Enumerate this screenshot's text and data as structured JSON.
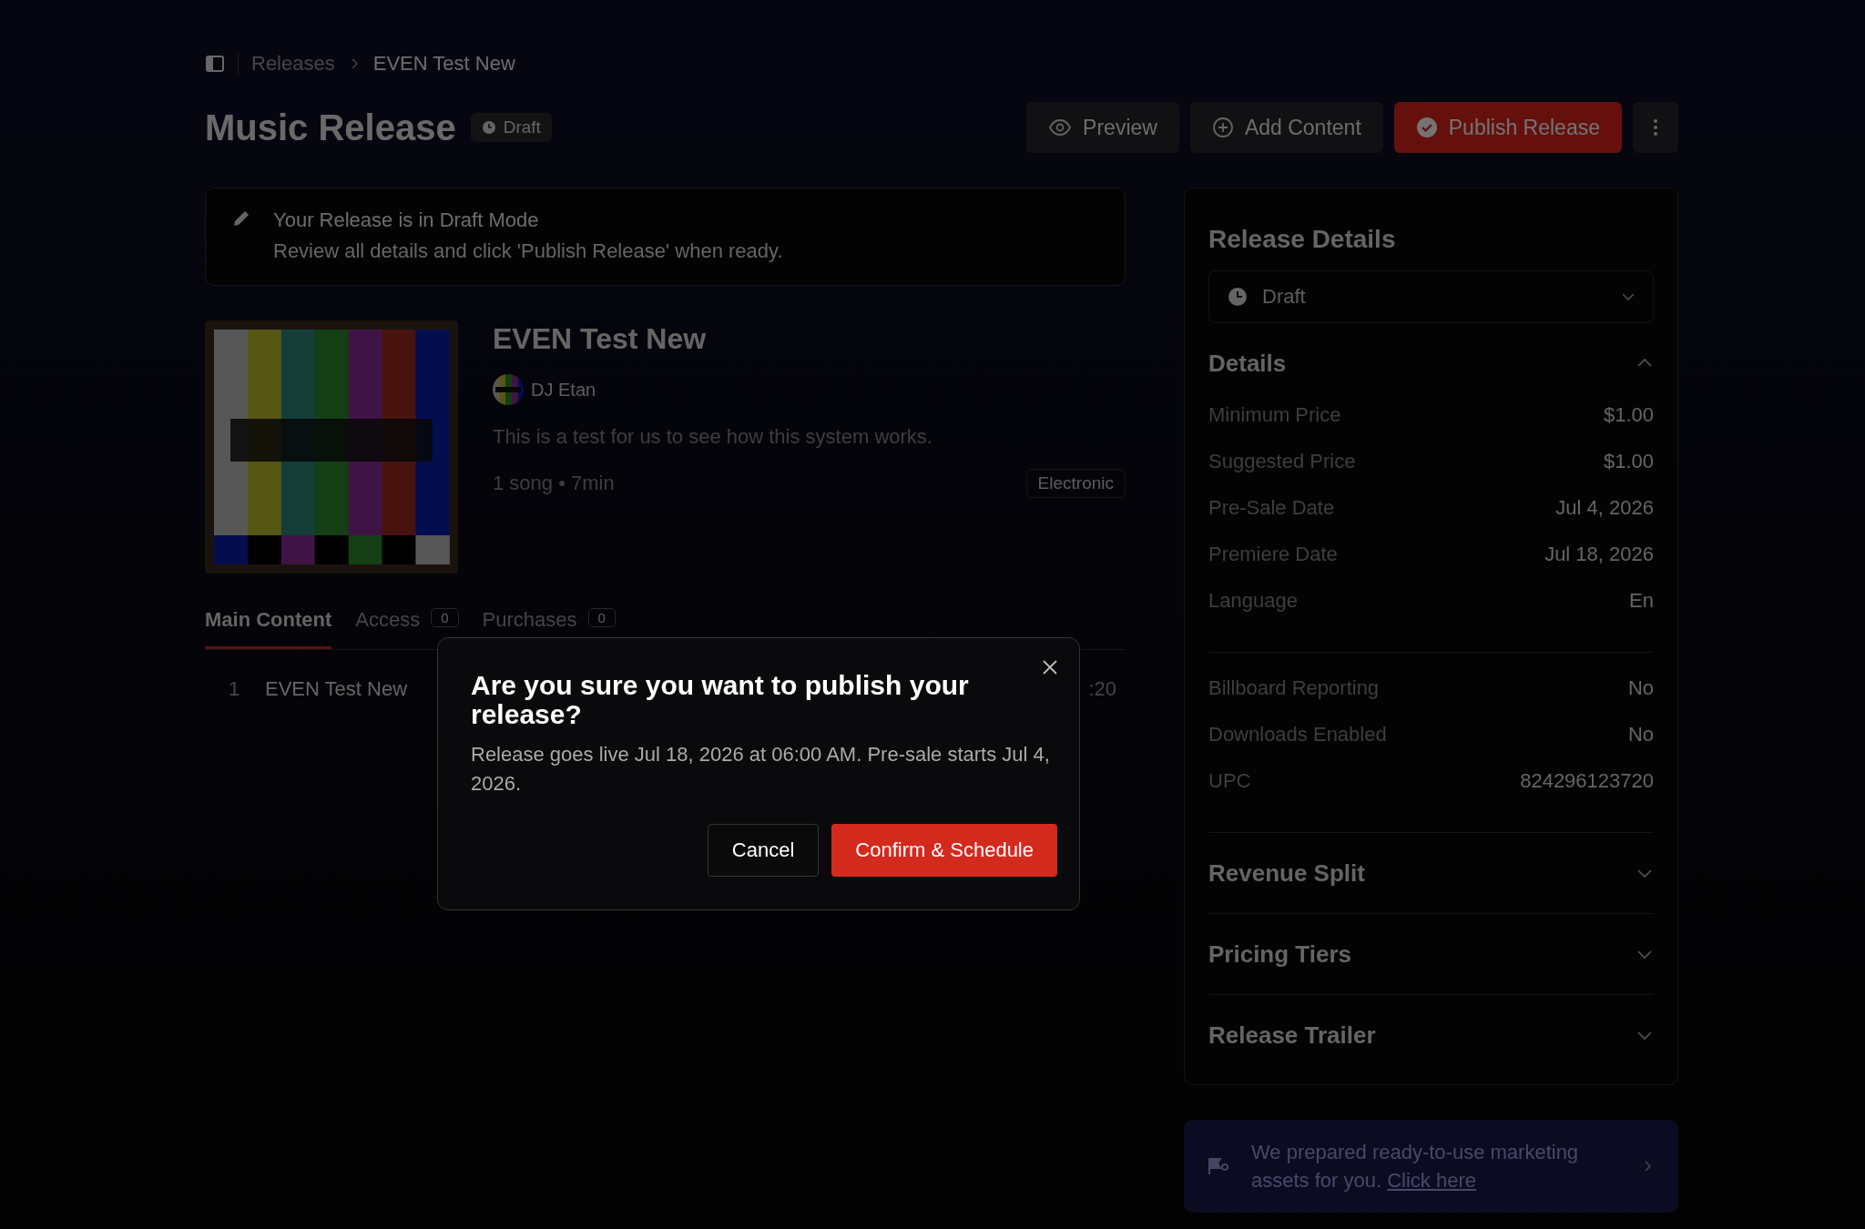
{
  "breadcrumb": {
    "items": [
      "Releases",
      "EVEN Test New"
    ]
  },
  "header": {
    "title": "Music Release",
    "status": "Draft",
    "actions": [
      {
        "label": "Preview",
        "kind": "preview"
      },
      {
        "label": "Add Content",
        "kind": "add"
      },
      {
        "label": "Publish Release",
        "kind": "publish"
      }
    ]
  },
  "notice": {
    "title": "Your Release is in Draft Mode",
    "text": "Review all details and click 'Publish Release' when ready."
  },
  "release": {
    "title": "EVEN Test New",
    "artist": "DJ Etan",
    "description": "This is a test for us to see how this system works.",
    "meta": "1 song • 7min",
    "genre": "Electronic"
  },
  "tabs": [
    {
      "label": "Main Content",
      "selected": true
    },
    {
      "label": "Access",
      "count": "0",
      "selected": false
    },
    {
      "label": "Purchases",
      "count": "0",
      "selected": false
    }
  ],
  "tracks": [
    {
      "number": "1",
      "title": "EVEN Test New",
      "duration": ":20"
    }
  ],
  "details_panel": {
    "title": "Release Details",
    "status": "Draft",
    "sections": [
      {
        "title": "Details",
        "expanded": true,
        "groups": [
          [
            {
              "label": "Minimum Price",
              "value": "$1.00"
            },
            {
              "label": "Suggested Price",
              "value": "$1.00"
            },
            {
              "label": "Pre-Sale Date",
              "value": "Jul 4, 2026"
            },
            {
              "label": "Premiere Date",
              "value": "Jul 18, 2026"
            },
            {
              "label": "Language",
              "value": "En"
            }
          ],
          [
            {
              "label": "Billboard Reporting",
              "value": "No"
            },
            {
              "label": "Downloads Enabled",
              "value": "No"
            },
            {
              "label": "UPC",
              "value": "824296123720"
            }
          ]
        ]
      },
      {
        "title": "Revenue Split",
        "expanded": false
      },
      {
        "title": "Pricing Tiers",
        "expanded": false
      },
      {
        "title": "Release Trailer",
        "expanded": false
      }
    ]
  },
  "banner": {
    "text": "We prepared ready-to-use marketing assets for you.",
    "link": "Click here"
  },
  "dialog": {
    "title": "Are you sure you want to publish your release?",
    "text": "Release goes live Jul 18, 2026 at 06:00 AM. Pre-sale starts Jul 4, 2026.",
    "cancel": "Cancel",
    "confirm": "Confirm & Schedule"
  }
}
